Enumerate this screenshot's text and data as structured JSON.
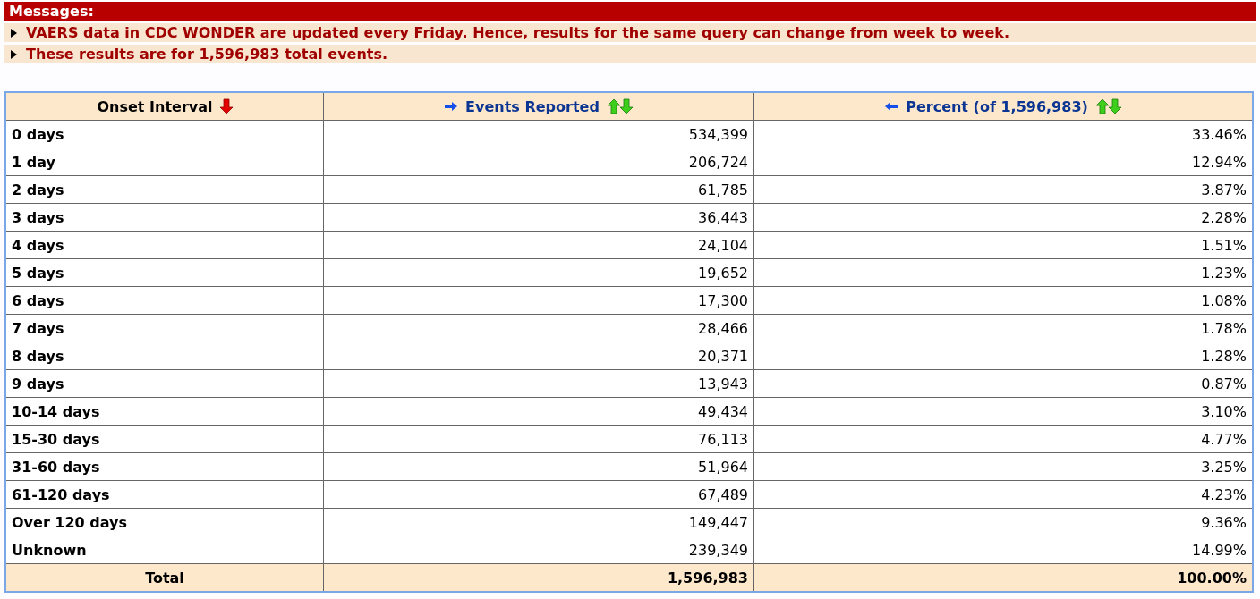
{
  "messages": {
    "title": "Messages:",
    "items": [
      "VAERS data in CDC WONDER are updated every Friday. Hence, results for the same query can change from week to week.",
      "These results are for 1,596,983 total events."
    ]
  },
  "table": {
    "columns": [
      {
        "label": "Onset Interval",
        "sorted": true,
        "kind": "fixed"
      },
      {
        "label": "Events Reported",
        "sorted": false,
        "kind": "right"
      },
      {
        "label": "Percent (of 1,596,983)",
        "sorted": false,
        "kind": "left"
      }
    ],
    "rows": [
      [
        "0 days",
        "534,399",
        "33.46%"
      ],
      [
        "1 day",
        "206,724",
        "12.94%"
      ],
      [
        "2 days",
        "61,785",
        "3.87%"
      ],
      [
        "3 days",
        "36,443",
        "2.28%"
      ],
      [
        "4 days",
        "24,104",
        "1.51%"
      ],
      [
        "5 days",
        "19,652",
        "1.23%"
      ],
      [
        "6 days",
        "17,300",
        "1.08%"
      ],
      [
        "7 days",
        "28,466",
        "1.78%"
      ],
      [
        "8 days",
        "20,371",
        "1.28%"
      ],
      [
        "9 days",
        "13,943",
        "0.87%"
      ],
      [
        "10-14 days",
        "49,434",
        "3.10%"
      ],
      [
        "15-30 days",
        "76,113",
        "4.77%"
      ],
      [
        "31-60 days",
        "51,964",
        "3.25%"
      ],
      [
        "61-120 days",
        "67,489",
        "4.23%"
      ],
      [
        "Over 120 days",
        "149,447",
        "9.36%"
      ],
      [
        "Unknown",
        "239,349",
        "14.99%"
      ]
    ],
    "total": [
      "Total",
      "1,596,983",
      "100.00%"
    ]
  }
}
